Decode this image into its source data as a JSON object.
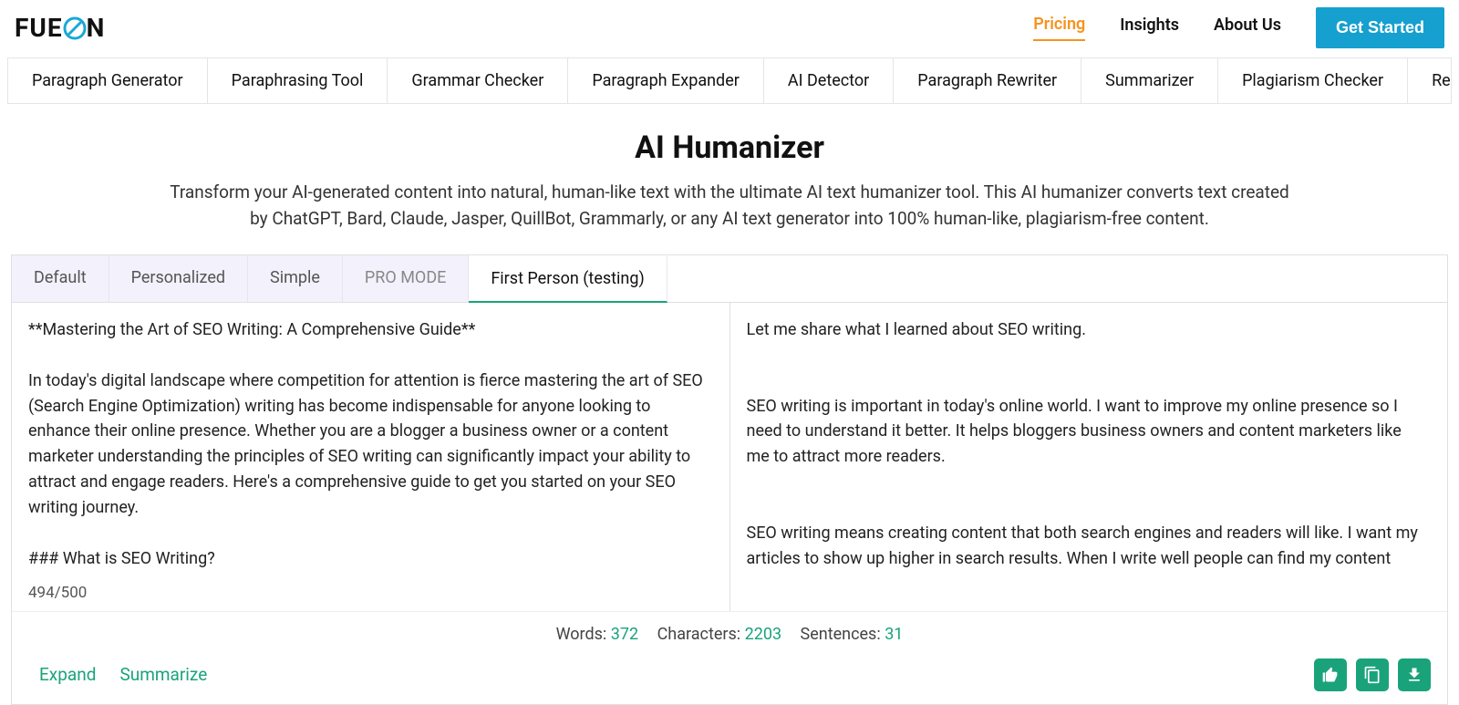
{
  "logo": {
    "pre": "FUE",
    "post": "N"
  },
  "topnav": {
    "items": [
      {
        "label": "Pricing",
        "active": true
      },
      {
        "label": "Insights",
        "active": false
      },
      {
        "label": "About Us",
        "active": false
      }
    ],
    "cta": "Get Started"
  },
  "toolbar": {
    "items": [
      "Paragraph Generator",
      "Paraphrasing Tool",
      "Grammar Checker",
      "Paragraph Expander",
      "AI Detector",
      "Paragraph Rewriter",
      "Summarizer",
      "Plagiarism Checker",
      "Readabilit"
    ]
  },
  "page": {
    "title": "AI Humanizer",
    "subtitle": "Transform your AI-generated content into natural, human-like text with the ultimate AI text humanizer tool. This AI humanizer converts text created by ChatGPT, Bard, Claude, Jasper, QuillBot, Grammarly, or any AI text generator into 100% human-like, plagiarism-free content."
  },
  "modes": {
    "items": [
      {
        "label": "Default",
        "active": false
      },
      {
        "label": "Personalized",
        "active": false
      },
      {
        "label": "Simple",
        "active": false
      },
      {
        "label": "PRO MODE",
        "active": false,
        "pro": true
      },
      {
        "label": "First Person (testing)",
        "active": true
      }
    ]
  },
  "input": {
    "text": "**Mastering the Art of SEO Writing: A Comprehensive Guide**\n\nIn today's digital landscape where competition for attention is fierce mastering the art of SEO (Search Engine Optimization) writing has become indispensable for anyone looking to enhance their online presence. Whether you are a blogger a business owner or a content marketer understanding the principles of SEO writing can significantly impact your ability to attract and engage readers. Here's a comprehensive guide to get you started on your SEO writing journey.\n\n### What is SEO Writing?",
    "counter": "494/500"
  },
  "output": {
    "text": "Let me share what I learned about SEO writing.\n\n\nSEO writing is important in today's online world. I want to improve my online presence so I need to understand it better. It helps bloggers business owners and content marketers like me to attract more readers.\n\n\nSEO writing means creating content that both search engines and readers will like. I want my articles to show up higher in search results. When I write well people can find my content easily and they enjoy reading it."
  },
  "stats": {
    "words_label": "Words:",
    "words": "372",
    "chars_label": "Characters:",
    "chars": "2203",
    "sent_label": "Sentences:",
    "sent": "31"
  },
  "actions": {
    "expand": "Expand",
    "summarize": "Summarize"
  },
  "icons": {
    "thumbs_up": "thumbs-up-icon",
    "copy": "copy-icon",
    "download": "download-icon"
  }
}
